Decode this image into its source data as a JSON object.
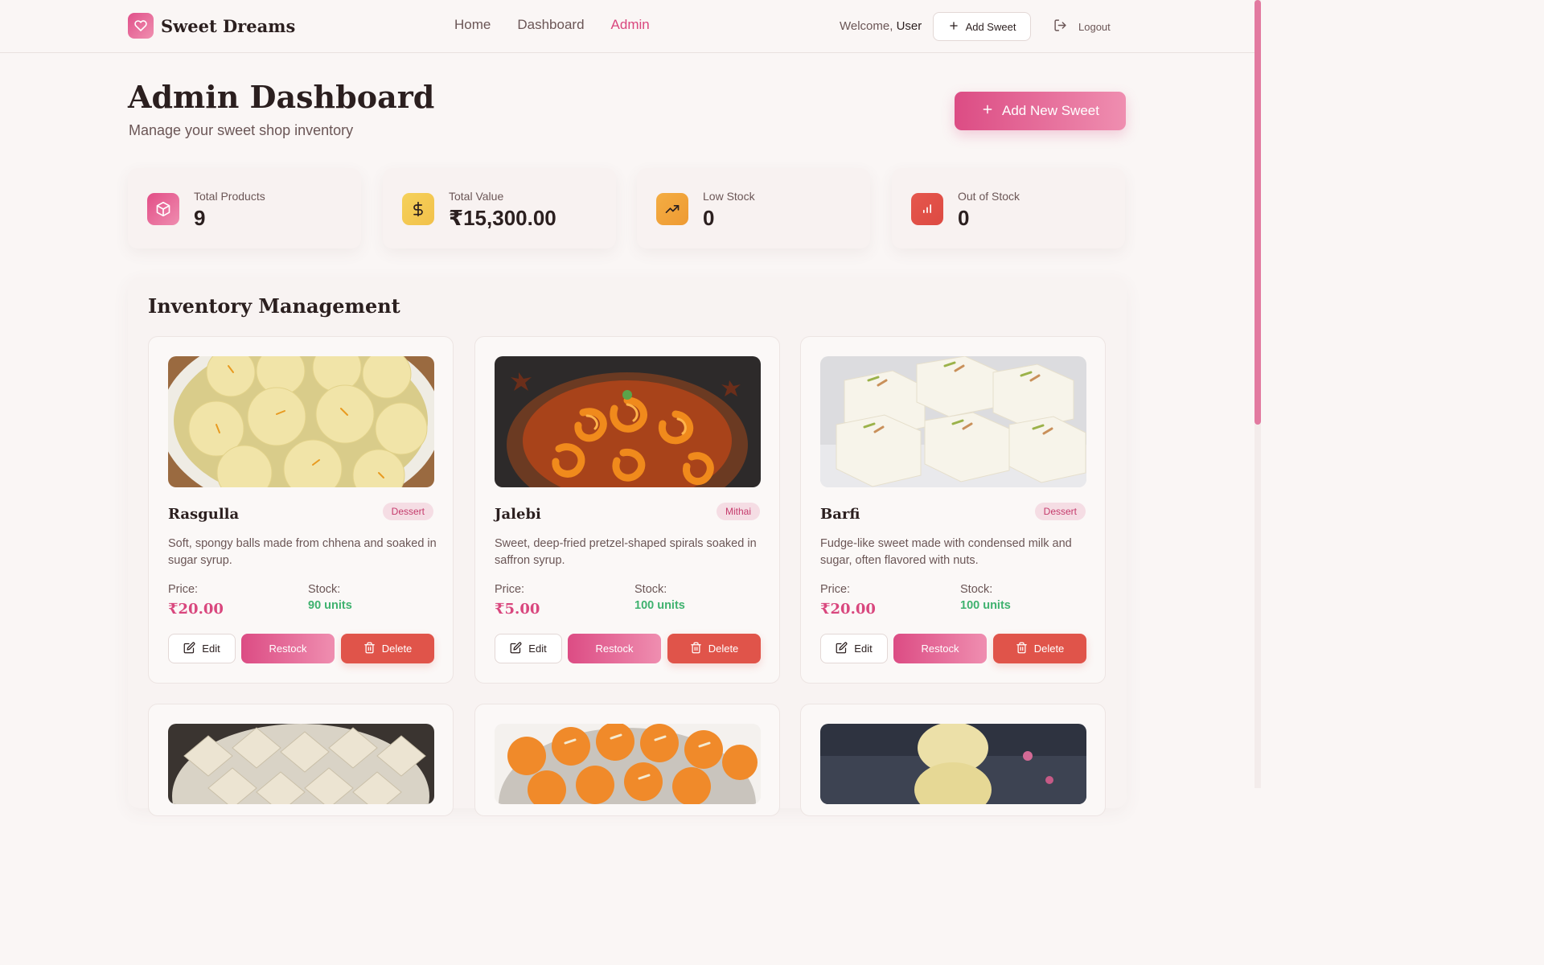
{
  "navbar": {
    "brand": "Sweet Dreams",
    "links": [
      "Home",
      "Dashboard",
      "Admin"
    ],
    "active_link": "Admin",
    "welcome_prefix": "Welcome,",
    "welcome_user": "User",
    "add_sweet_label": "Add Sweet",
    "logout_label": "Logout"
  },
  "header": {
    "title": "Admin Dashboard",
    "subtitle": "Manage your sweet shop inventory",
    "add_new_label": "Add New Sweet"
  },
  "stats": [
    {
      "label": "Total Products",
      "value": "9",
      "icon": "package-icon",
      "color": "#e4578c"
    },
    {
      "label": "Total Value",
      "value": "₹15,300.00",
      "icon": "dollar-icon",
      "color": "#f2c94c"
    },
    {
      "label": "Low Stock",
      "value": "0",
      "icon": "trending-up-icon",
      "color": "#f0a13a"
    },
    {
      "label": "Out of Stock",
      "value": "0",
      "icon": "bar-chart-icon",
      "color": "#e0544a"
    }
  ],
  "inventory": {
    "title": "Inventory Management",
    "price_label": "Price:",
    "stock_label": "Stock:",
    "edit_label": "Edit",
    "restock_label": "Restock",
    "delete_label": "Delete",
    "items": [
      {
        "name": "Rasgulla",
        "category": "Dessert",
        "description": "Soft, spongy balls made from chhena and soaked in sugar syrup.",
        "price": "₹20.00",
        "stock": "90 units"
      },
      {
        "name": "Jalebi",
        "category": "Mithai",
        "description": "Sweet, deep-fried pretzel-shaped spirals soaked in saffron syrup.",
        "price": "₹5.00",
        "stock": "100 units"
      },
      {
        "name": "Barfi",
        "category": "Dessert",
        "description": "Fudge-like sweet made with condensed milk and sugar, often flavored with nuts.",
        "price": "₹20.00",
        "stock": "100 units"
      }
    ]
  },
  "colors": {
    "accent": "#d9477e",
    "danger": "#e0544a",
    "success": "#3fb26f"
  }
}
